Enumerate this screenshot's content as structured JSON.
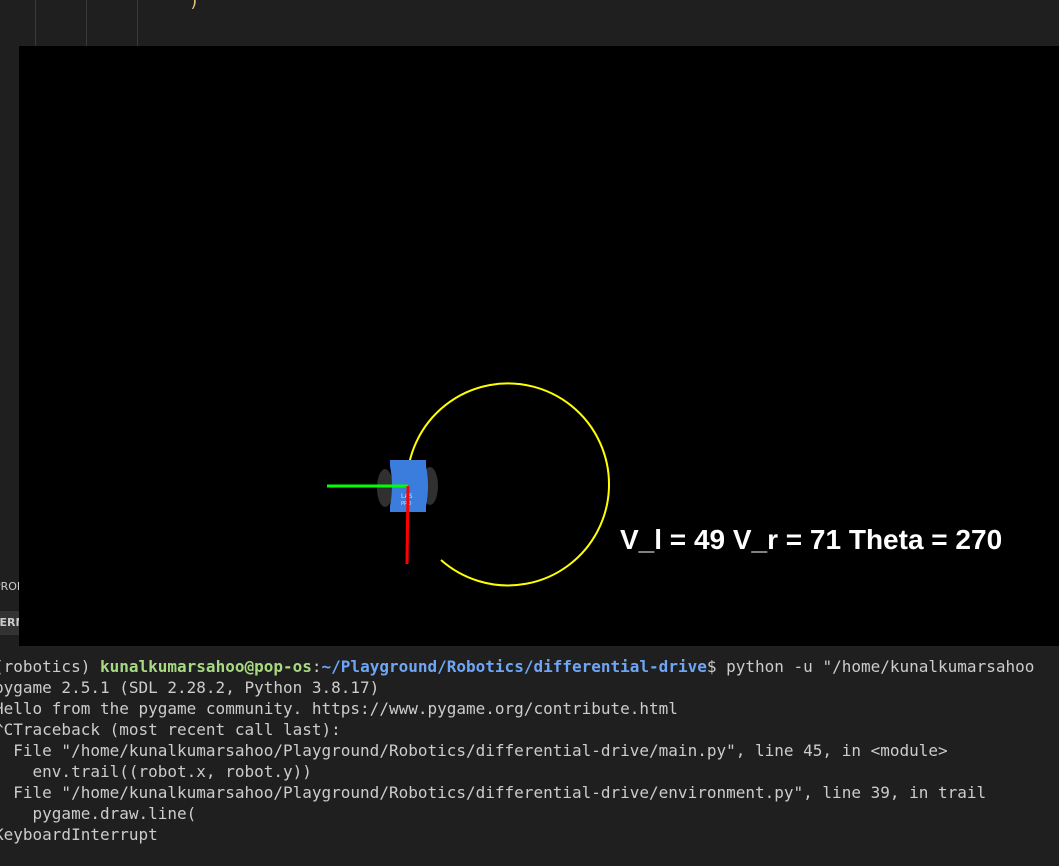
{
  "editor": {
    "code_fragment": ")"
  },
  "side_panel": {
    "problems_tab": "PROBLEMS",
    "terminal_tab": "TERMINAL"
  },
  "simulation": {
    "readout": "V_l = 49 V_r = 71 Theta = 270",
    "colors": {
      "background": "#000000",
      "trail": "#ffff00",
      "robot_body": "#3b7ddd",
      "x_axis": "#00ff00",
      "y_axis": "#ff0000",
      "wheel": "#303030"
    }
  },
  "terminal": {
    "prompt_env": "(robotics) ",
    "prompt_user": "kunalkumarsahoo@pop-os",
    "prompt_sep": ":",
    "prompt_path": "~/Playground/Robotics/differential-drive",
    "prompt_command": "$ python -u \"/home/kunalkumarsahoo",
    "lines": [
      "pygame 2.5.1 (SDL 2.28.2, Python 3.8.17)",
      "Hello from the pygame community. https://www.pygame.org/contribute.html",
      "^CTraceback (most recent call last):",
      "  File \"/home/kunalkumarsahoo/Playground/Robotics/differential-drive/main.py\", line 45, in <module>",
      "    env.trail((robot.x, robot.y))",
      "  File \"/home/kunalkumarsahoo/Playground/Robotics/differential-drive/environment.py\", line 39, in trail",
      "    pygame.draw.line(",
      "KeyboardInterrupt"
    ]
  }
}
